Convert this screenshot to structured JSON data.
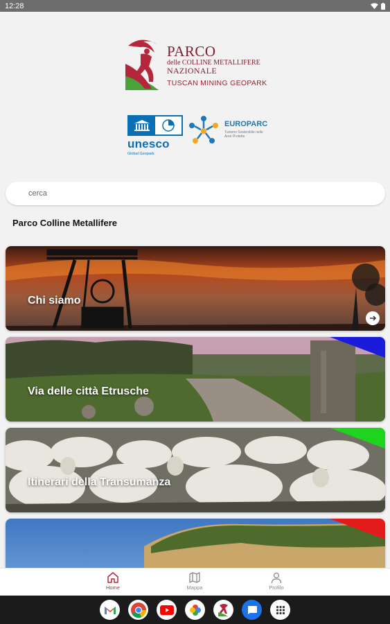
{
  "status_bar": {
    "time": "12:28"
  },
  "logos": {
    "park_line1": "PARCO",
    "park_line1_small": "NAZIONALE",
    "park_line2": "delle COLLINE METALLIFERE",
    "park_line3": "TUSCAN MINING GEOPARK",
    "unesco": "unesco",
    "unesco_sub": "Global Geopark",
    "europarc": "EUROPARC",
    "europarc_sub": "Turismo Sostenibile nelle Aree Protette"
  },
  "search": {
    "placeholder": "cerca"
  },
  "section_title": "Parco Colline Metallifere",
  "cards": [
    {
      "title": "Chi siamo"
    },
    {
      "title": "Via delle città Etrusche",
      "corner_color": "#1b1bdb"
    },
    {
      "title": "Itinerari della Transumanza",
      "corner_color": "#1fd41f"
    },
    {
      "title": "",
      "corner_color": "#e31b1b"
    }
  ],
  "bottom_nav": [
    {
      "label": "Home",
      "icon": "home-icon",
      "active": true
    },
    {
      "label": "Mappa",
      "icon": "map-icon",
      "active": false
    },
    {
      "label": "Profilo",
      "icon": "profile-icon",
      "active": false
    }
  ],
  "android_apps": [
    "gmail-icon",
    "chrome-icon",
    "youtube-icon",
    "photos-icon",
    "park-app-icon",
    "messages-icon",
    "app-drawer-icon"
  ],
  "colors": {
    "accent": "#b3263b",
    "park_red": "#7b1d2a",
    "unesco_blue": "#0a6fb5"
  }
}
